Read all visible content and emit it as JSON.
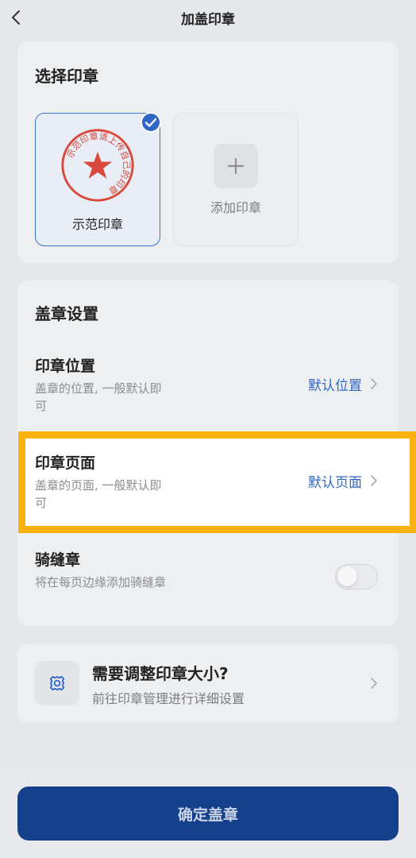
{
  "header": {
    "title": "加盖印章"
  },
  "select_seal": {
    "title": "选择印章",
    "seals": [
      {
        "name": "示范印章",
        "selected": true,
        "ring_text": "示范印章请上传自己的印章"
      }
    ],
    "add_label": "添加印章"
  },
  "settings": {
    "title": "盖章设置",
    "position": {
      "title": "印章位置",
      "desc": "盖章的位置, 一般默认即可",
      "value": "默认位置"
    },
    "page": {
      "title": "印章页面",
      "desc": "盖章的页面, 一般默认即可",
      "value": "默认页面"
    },
    "seam": {
      "title": "骑缝章",
      "desc": "将在每页边缘添加骑缝章",
      "enabled": false
    }
  },
  "tip": {
    "title": "需要调整印章大小?",
    "subtitle": "前往印章管理进行详细设置"
  },
  "footer": {
    "confirm_label": "确定盖章"
  },
  "colors": {
    "accent": "#2f67c7",
    "seal_red": "#d9483b",
    "highlight": "#f9b20f",
    "button": "#143f8a"
  }
}
